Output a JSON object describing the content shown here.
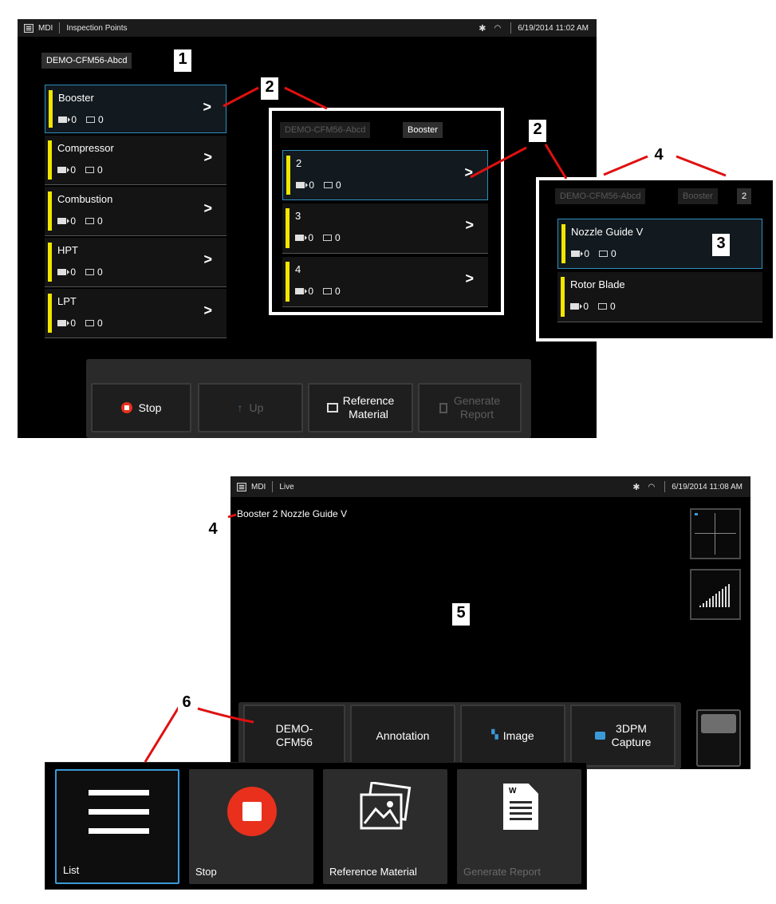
{
  "top_screen": {
    "statusbar": {
      "app": "MDI",
      "view": "Inspection Points",
      "datetime": "6/19/2014 11:02 AM",
      "bluetooth_icon": "bluetooth-icon",
      "wifi_icon": "wifi-icon"
    },
    "breadcrumb": "DEMO-CFM56-Abcd",
    "items": [
      {
        "label": "Booster",
        "videos": "0",
        "images": "0"
      },
      {
        "label": "Compressor",
        "videos": "0",
        "images": "0"
      },
      {
        "label": "Combustion",
        "videos": "0",
        "images": "0"
      },
      {
        "label": "HPT",
        "videos": "0",
        "images": "0"
      },
      {
        "label": "LPT",
        "videos": "0",
        "images": "0"
      }
    ],
    "softkeys": {
      "stop": "Stop",
      "up": "Up",
      "reference": "Reference\nMaterial",
      "report": "Generate\nReport"
    }
  },
  "panel_a": {
    "crumbs": [
      "DEMO-CFM56-Abcd",
      "Booster"
    ],
    "items": [
      {
        "label": "2",
        "videos": "0",
        "images": "0"
      },
      {
        "label": "3",
        "videos": "0",
        "images": "0"
      },
      {
        "label": "4",
        "videos": "0",
        "images": "0"
      }
    ]
  },
  "panel_b": {
    "crumbs": [
      "DEMO-CFM56-Abcd",
      "Booster",
      "2"
    ],
    "items": [
      {
        "label": "Nozzle Guide V",
        "videos": "0",
        "images": "0"
      },
      {
        "label": "Rotor Blade",
        "videos": "0",
        "images": "0"
      }
    ]
  },
  "live_screen": {
    "statusbar": {
      "app": "MDI",
      "view": "Live",
      "datetime": "6/19/2014 11:08 AM"
    },
    "overlay_title": "Booster 2 Nozzle Guide V",
    "softkeys": {
      "demo": "DEMO-\nCFM56",
      "annotation": "Annotation",
      "image": "Image",
      "capture": "3DPM\nCapture"
    }
  },
  "big_softkeys": {
    "list": "List",
    "stop": "Stop",
    "reference": "Reference Material",
    "report": "Generate Report",
    "report_doc_letter": "W"
  },
  "callouts": {
    "c1": "1",
    "c2a": "2",
    "c2b": "2",
    "c3": "3",
    "c4a": "4",
    "c4b": "4",
    "c5": "5",
    "c6": "6"
  },
  "colors": {
    "accent_yellow": "#f2e600",
    "selection_blue": "#2f8fbf",
    "callout_red": "#e01010",
    "stop_red": "#e8301c"
  }
}
